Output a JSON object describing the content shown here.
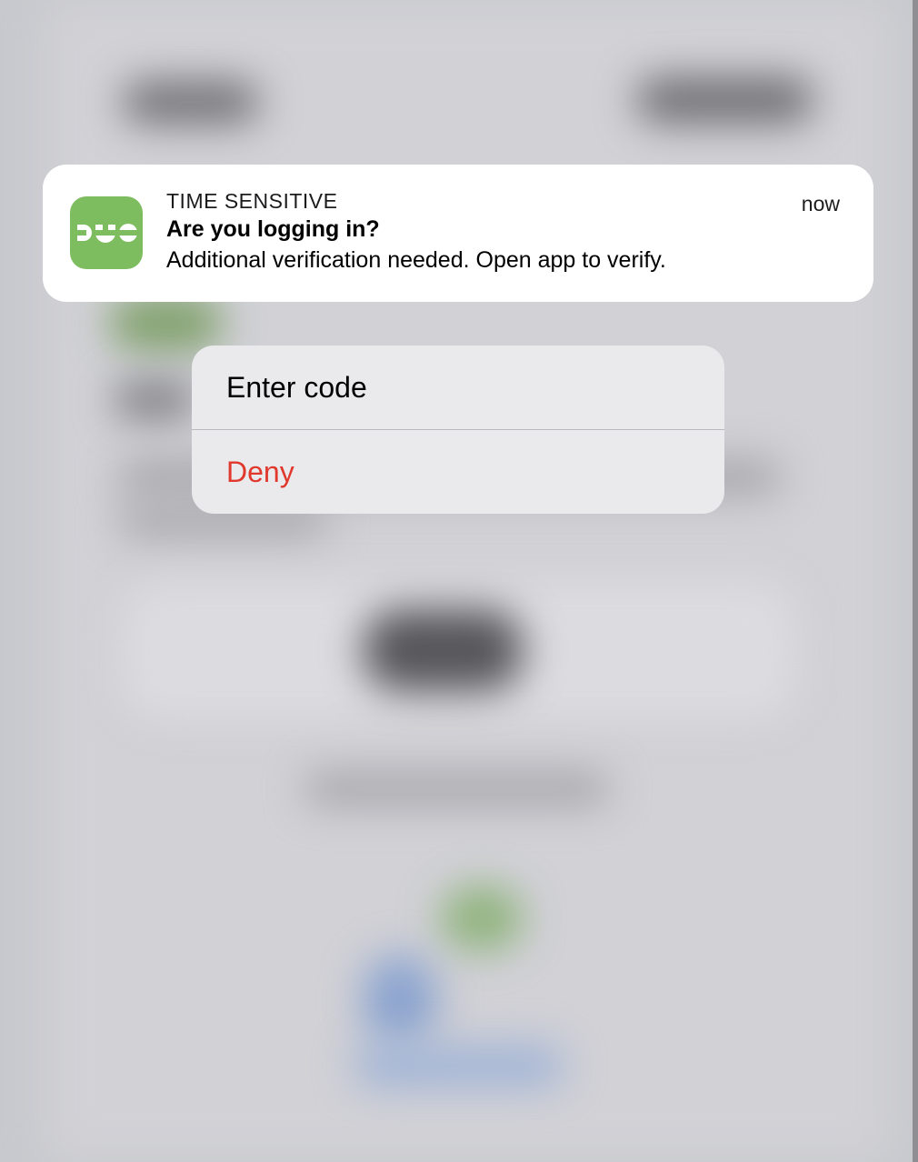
{
  "notification": {
    "app_name": "DUO",
    "app_icon": "duo-app-icon",
    "category": "TIME SENSITIVE",
    "time": "now",
    "title": "Are you logging in?",
    "body": "Additional verification needed. Open app to verify.",
    "icon_color": "#7dbd5f"
  },
  "actions": {
    "enter_code_label": "Enter code",
    "deny_label": "Deny",
    "deny_color": "#e0382d"
  }
}
